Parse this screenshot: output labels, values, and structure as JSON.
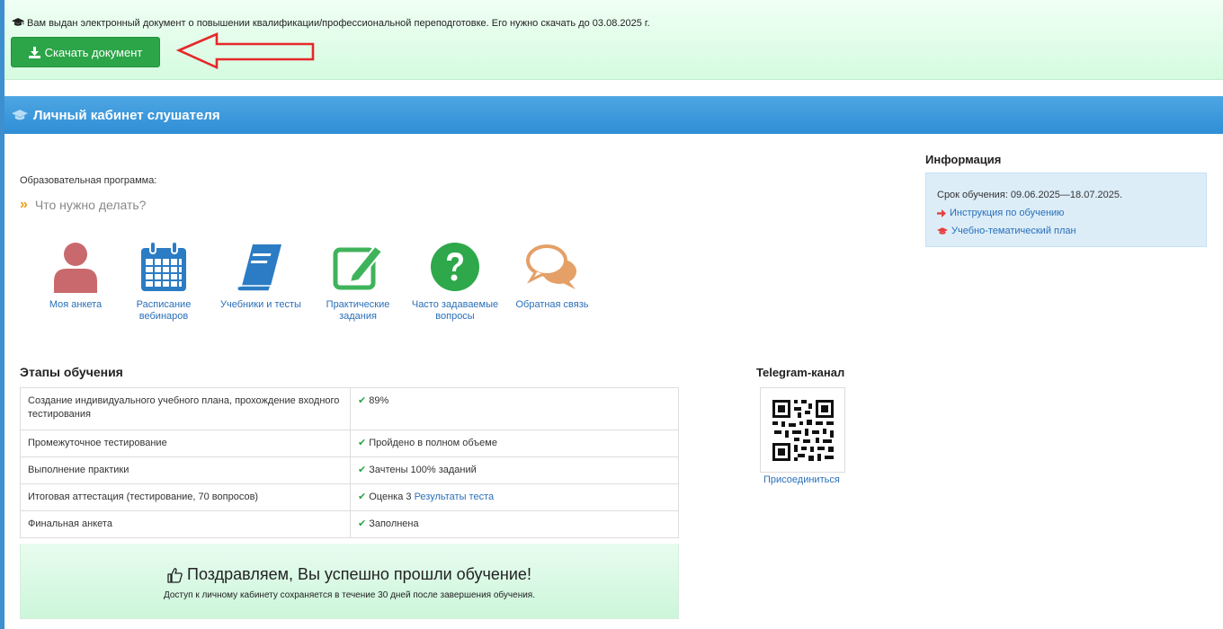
{
  "notice": {
    "text": "Вам выдан электронный документ о повышении квалификации/профессиональной переподготовке. Его нужно скачать до 03.08.2025 г.",
    "download_label": "Скачать документ"
  },
  "header": {
    "title": "Личный кабинет слушателя"
  },
  "program": {
    "label": "Образовательная программа:",
    "todo": "Что нужно делать?"
  },
  "icons": [
    {
      "line1": "Моя анкета",
      "line2": "",
      "icon": "user-icon",
      "color": "#c9696d"
    },
    {
      "line1": "Расписание",
      "line2": "вебинаров",
      "icon": "calendar-icon",
      "color": "#2b7cc4"
    },
    {
      "line1": "Учебники и тесты",
      "line2": "",
      "icon": "book-icon",
      "color": "#2b7cc4"
    },
    {
      "line1": "Практические",
      "line2": "задания",
      "icon": "edit-icon",
      "color": "#3fb35b"
    },
    {
      "line1": "Часто задаваемые",
      "line2": "вопросы",
      "icon": "question-icon",
      "color": "#2ea84a"
    },
    {
      "line1": "Обратная связь",
      "line2": "",
      "icon": "chat-icon",
      "color": "#e4a067"
    }
  ],
  "stages": {
    "title": "Этапы обучения",
    "rows": [
      {
        "name": "Создание индивидуального учебного плана, прохождение входного тестирования",
        "status": "89%",
        "link": ""
      },
      {
        "name": "Промежуточное тестирование",
        "status": "Пройдено в полном объеме",
        "link": ""
      },
      {
        "name": "Выполнение практики",
        "status": "Зачтены 100% заданий",
        "link": ""
      },
      {
        "name": "Итоговая аттестация (тестирование, 70 вопросов)",
        "status": "Оценка 3",
        "link": "Результаты теста"
      },
      {
        "name": "Финальная анкета",
        "status": "Заполнена",
        "link": ""
      }
    ]
  },
  "congrats": {
    "title": "Поздравляем, Вы успешно прошли обучение!",
    "subtitle": "Доступ к личному кабинету сохраняется в течение 30 дней после завершения обучения."
  },
  "telegram": {
    "title": "Telegram-канал",
    "join": "Присоединиться"
  },
  "info": {
    "title": "Информация",
    "period": "Срок обучения: 09.06.2025—18.07.2025.",
    "instruction": "Инструкция по обучению",
    "plan": "Учебно-тематический план"
  },
  "colors": {
    "accent": "#2f8ed6",
    "success": "#2ca548",
    "link": "#2a6fb8"
  }
}
